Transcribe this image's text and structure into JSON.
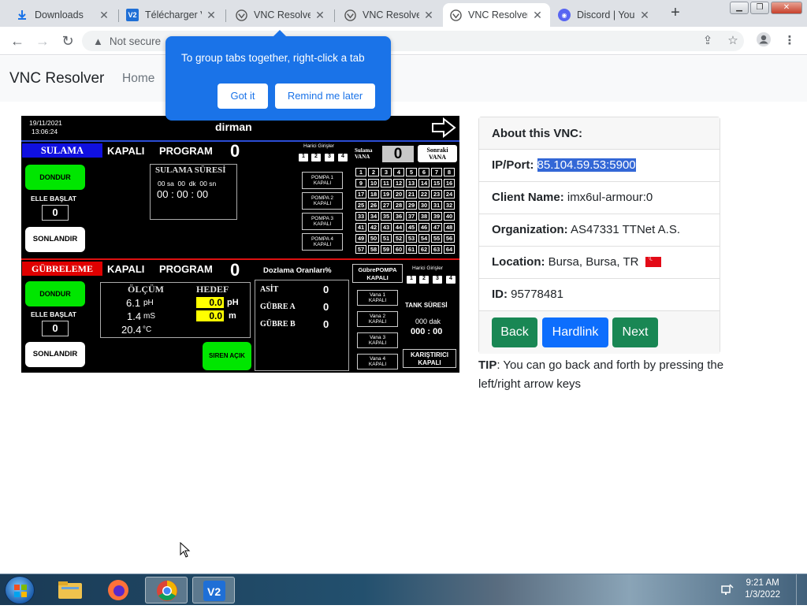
{
  "browser": {
    "tabs": [
      {
        "title": "Downloads",
        "icon": "download-icon",
        "active": false
      },
      {
        "title": "Télécharger V",
        "icon": "vnc-viewer-icon",
        "active": false
      },
      {
        "title": "VNC Resolver",
        "icon": "vnc-resolver-icon",
        "active": false
      },
      {
        "title": "VNC Resolver",
        "icon": "vnc-resolver-icon",
        "active": false
      },
      {
        "title": "VNC Resolver",
        "icon": "vnc-resolver-icon",
        "active": true
      },
      {
        "title": "Discord | Your",
        "icon": "discord-icon",
        "active": false
      }
    ],
    "address": "Not secure",
    "popup": {
      "message": "To group tabs together, right-click a tab",
      "got_it": "Got it",
      "remind": "Remind me later"
    }
  },
  "site": {
    "brand": "VNC Resolver",
    "nav_home": "Home"
  },
  "hmi": {
    "date": "19/11/2021",
    "time": "13:06:24",
    "title": "dirman",
    "sulama": "SULAMA",
    "kapali": "KAPALI",
    "program": "PROGRAM",
    "program_no": "0",
    "harici_girisler": "Harici Girişler",
    "inputs": [
      "1",
      "2",
      "3",
      "4"
    ],
    "sulama_vana": "Sulama VANA",
    "vana_value": "0",
    "sonraki_vana": "Sonraki VANA",
    "dondur": "DONDUR",
    "elle_baslat": "ELLE BAŞLAT",
    "elle_value": "0",
    "sonlandir": "SONLANDIR",
    "sulama_suresi": "SULAMA SÜRESİ",
    "sure_units": "00 sa  00  dk  00 sn",
    "sure_time": "00 : 00 : 00",
    "pompa": [
      [
        "POMPA 1",
        "KAPALI"
      ],
      [
        "POMPA 2",
        "KAPALI"
      ],
      [
        "POMPA 3",
        "KAPALI"
      ],
      [
        "POMPA 4",
        "KAPALI"
      ]
    ],
    "valves": [
      "1",
      "2",
      "3",
      "4",
      "5",
      "6",
      "7",
      "8",
      "9",
      "10",
      "11",
      "12",
      "13",
      "14",
      "15",
      "16",
      "17",
      "18",
      "19",
      "20",
      "21",
      "22",
      "23",
      "24",
      "25",
      "26",
      "27",
      "28",
      "29",
      "30",
      "31",
      "32",
      "33",
      "34",
      "35",
      "36",
      "37",
      "38",
      "39",
      "40",
      "41",
      "42",
      "43",
      "44",
      "45",
      "46",
      "47",
      "48",
      "49",
      "50",
      "51",
      "52",
      "53",
      "54",
      "55",
      "56",
      "57",
      "58",
      "59",
      "60",
      "61",
      "62",
      "63",
      "64"
    ],
    "gubreleme": "GÜBRELEME",
    "g_kapali": "KAPALI",
    "g_program": "PROGRAM",
    "g_program_no": "0",
    "olcum": "ÖLÇÜM",
    "hedef": "HEDEF",
    "ph_value": "6.1",
    "ph_unit": "pH",
    "ms_value": "1.4",
    "ms_unit": "mS",
    "temp_value": "20.4",
    "temp_unit": "°C",
    "hedef_ph": "0.0",
    "hedef_ph_unit": "pH",
    "hedef_m": "0.0",
    "hedef_m_unit": "m",
    "g_dondur": "DONDUR",
    "g_elle_baslat": "ELLE BAŞLAT",
    "g_elle_value": "0",
    "g_sonlandir": "SONLANDIR",
    "siren": "SIREN AÇIK",
    "dozlama": "Dozlama Oranları%",
    "asit": "ASİT",
    "asit_value": "0",
    "gubre_a": "GÜBRE A",
    "gubre_a_value": "0",
    "gubre_b": "GÜBRE B",
    "gubre_b_value": "0",
    "gubre_pompa": "GübrePOMPA",
    "gubre_pompa_state": "KAPALI",
    "g_harici": "Harici Girişler",
    "g_inputs": [
      "1",
      "2",
      "3",
      "4"
    ],
    "vana": [
      [
        "Vana 1",
        "KAPALI"
      ],
      [
        "Vana 2",
        "KAPALI"
      ],
      [
        "Vana 3",
        "KAPALI"
      ],
      [
        "Vana 4",
        "KAPALI"
      ]
    ],
    "tank_suresi": "TANK SÜRESİ",
    "tank_units": "000 dak",
    "tank_time": "000 : 00",
    "karistirici": "KARIŞTIRICI",
    "karistirici_state": "KAPALI"
  },
  "card": {
    "header": "About this VNC:",
    "ip_label": "IP/Port:",
    "ip_value": "85.104.59.53:5900",
    "client_label": "Client Name:",
    "client_value": "imx6ul-armour:0",
    "org_label": "Organization:",
    "org_value": "AS47331 TTNet A.S.",
    "loc_label": "Location:",
    "loc_value": "Bursa, Bursa, TR",
    "id_label": "ID:",
    "id_value": "95778481",
    "back": "Back",
    "hardlink": "Hardlink",
    "next": "Next"
  },
  "tip": {
    "label": "TIP",
    "text": ": You can go back and forth by pressing the left/right arrow keys"
  },
  "taskbar": {
    "time": "9:21 AM",
    "date": "1/3/2022"
  },
  "colors": {
    "bootstrap_green": "#198754",
    "bootstrap_blue": "#0d6efd",
    "chrome_blue": "#1a73e8"
  }
}
